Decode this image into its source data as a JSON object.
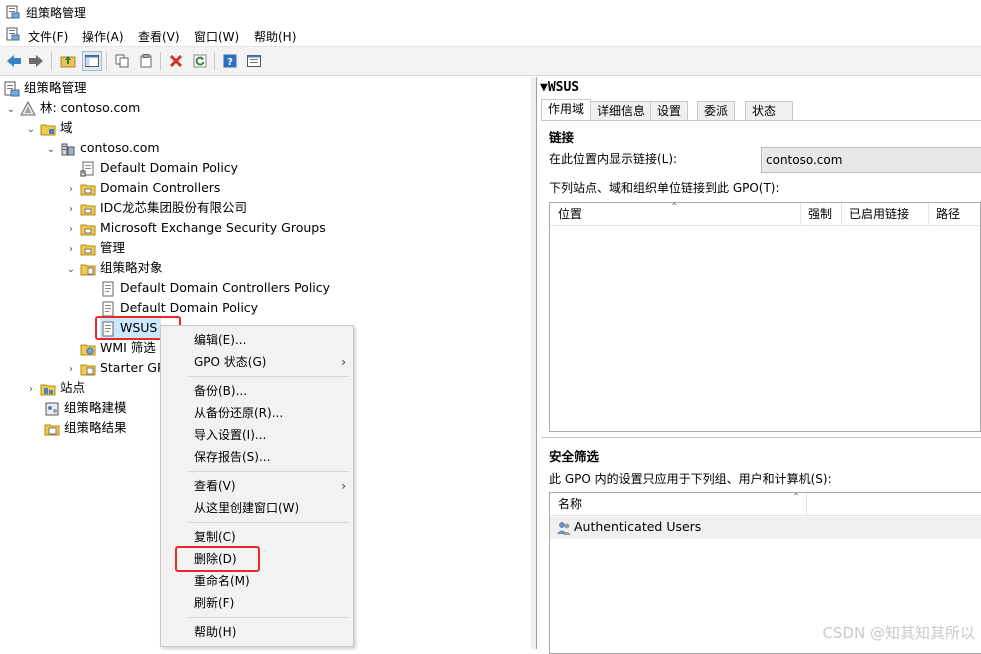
{
  "window": {
    "title": "组策略管理"
  },
  "menu": [
    "文件(F)",
    "操作(A)",
    "查看(V)",
    "窗口(W)",
    "帮助(H)"
  ],
  "tree": {
    "root": "组策略管理",
    "forest": "林: contoso.com",
    "domains": "域",
    "domain": "contoso.com",
    "items": [
      "Default Domain Policy",
      "Domain Controllers",
      "IDC龙芯集团股份有限公司",
      "Microsoft Exchange Security Groups",
      "管理",
      "组策略对象"
    ],
    "gpo_children": [
      "Default Domain Controllers Policy",
      "Default Domain Policy",
      "WSUS"
    ],
    "wmi": "WMI 筛选",
    "starter": "Starter GP",
    "sites": "站点",
    "modeling": "组策略建模",
    "results": "组策略结果"
  },
  "context_menu": {
    "items": [
      "编辑(E)...",
      "GPO 状态(G)",
      "备份(B)...",
      "从备份还原(R)...",
      "导入设置(I)...",
      "保存报告(S)...",
      "查看(V)",
      "从这里创建窗口(W)",
      "复制(C)",
      "删除(D)",
      "重命名(M)",
      "刷新(F)",
      "帮助(H)"
    ]
  },
  "right": {
    "title": "WSUS",
    "tabs": [
      "作用域",
      "详细信息",
      "设置",
      "委派",
      "状态"
    ],
    "links_title": "链接",
    "links_location_label": "在此位置内显示链接(L):",
    "links_location_value": "contoso.com",
    "links_desc": "下列站点、域和组织单位链接到此 GPO(T):",
    "links_columns": [
      "位置",
      "强制",
      "已启用链接",
      "路径"
    ],
    "security_title": "安全筛选",
    "security_desc": "此 GPO 内的设置只应用于下列组、用户和计算机(S):",
    "security_columns": [
      "名称"
    ],
    "security_rows": [
      "Authenticated Users"
    ]
  },
  "watermark": "CSDN @知其知其所以",
  "colors": {
    "highlight": "#e8292c",
    "selection": "#cce8ff"
  },
  "icons": [
    "gpm-icon",
    "back-arrow-icon",
    "forward-arrow-icon",
    "up-folder-icon",
    "show-tree-icon",
    "copy-icon",
    "paste-icon",
    "delete-x-icon",
    "refresh-icon",
    "help-icon",
    "properties-icon",
    "forest-icon",
    "folder-icon",
    "domain-icon",
    "gpo-link-icon",
    "ou-icon",
    "gpo-icon",
    "wmi-icon",
    "starter-icon",
    "sites-icon",
    "modeling-icon",
    "results-icon",
    "users-icon"
  ]
}
